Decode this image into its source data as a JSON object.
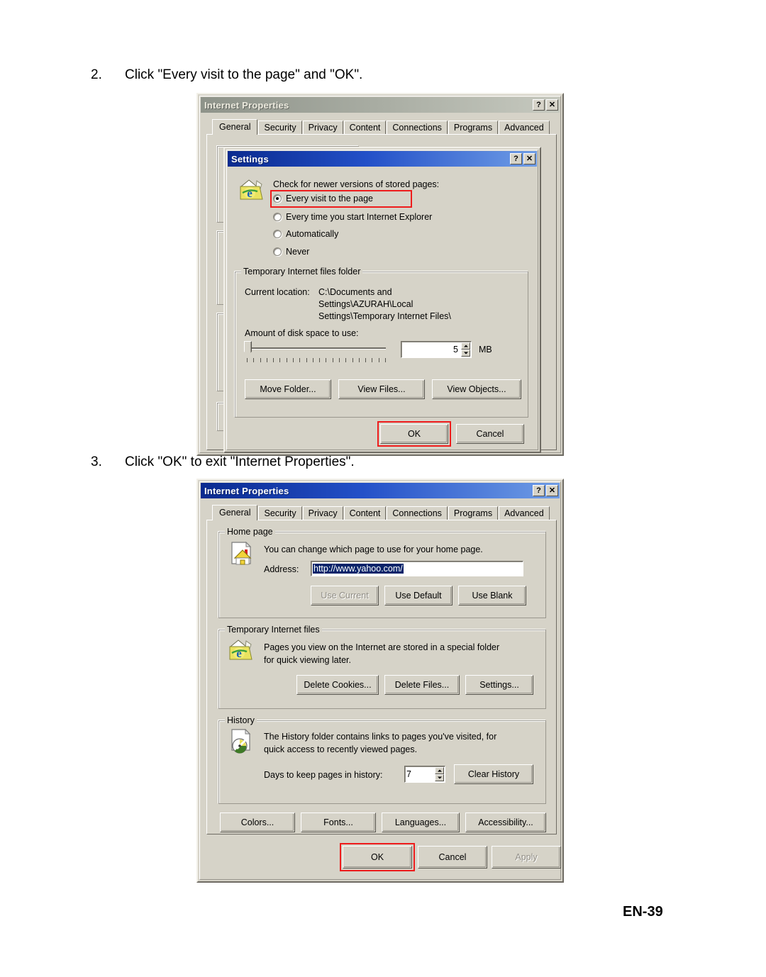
{
  "document": {
    "footer_label": "EN-39"
  },
  "steps": [
    {
      "num": "2.",
      "text": "Click \"Every visit to the page\" and \"OK\"."
    },
    {
      "num": "3.",
      "text": "Click \"OK\" to exit \"Internet Properties\"."
    }
  ],
  "colors": {
    "highlight": "#ee1c1c",
    "dialog_face": "#d6d3c8",
    "active_title": "#0a2a8f",
    "inactive_title": "#8e938a",
    "selection": "#0a246a"
  },
  "dialog_1": {
    "title": "Internet Properties",
    "title_state": "inactive",
    "help_button": "?",
    "close_button": "✕",
    "tabs": [
      {
        "label": "General",
        "selected": true
      },
      {
        "label": "Security",
        "selected": false
      },
      {
        "label": "Privacy",
        "selected": false
      },
      {
        "label": "Content",
        "selected": false
      },
      {
        "label": "Connections",
        "selected": false
      },
      {
        "label": "Programs",
        "selected": false
      },
      {
        "label": "Advanced",
        "selected": false
      }
    ],
    "settings_dialog": {
      "title": "Settings",
      "title_state": "active",
      "help_button": "?",
      "close_button": "✕",
      "check_label": "Check for newer versions of stored pages:",
      "radios": [
        {
          "label": "Every visit to the page",
          "selected": true,
          "highlighted": true
        },
        {
          "label": "Every time you start Internet Explorer",
          "selected": false,
          "highlighted": false
        },
        {
          "label": "Automatically",
          "selected": false,
          "highlighted": false
        },
        {
          "label": "Never",
          "selected": false,
          "highlighted": false
        }
      ],
      "temp_folder_group": {
        "legend": "Temporary Internet files folder",
        "current_location_label": "Current location:",
        "current_location_lines": [
          "C:\\Documents and",
          "Settings\\AZURAH\\Local",
          "Settings\\Temporary Internet Files\\"
        ],
        "disk_space_label": "Amount of disk space to use:",
        "disk_space_value": "5",
        "disk_space_unit": "MB",
        "slider_position_percent": 3,
        "buttons": [
          {
            "label": "Move Folder...",
            "enabled": true
          },
          {
            "label": "View Files...",
            "enabled": true
          },
          {
            "label": "View Objects...",
            "enabled": true
          }
        ]
      },
      "footer_buttons": [
        {
          "label": "OK",
          "enabled": true,
          "highlighted": true
        },
        {
          "label": "Cancel",
          "enabled": true,
          "highlighted": false
        }
      ]
    }
  },
  "dialog_2": {
    "title": "Internet Properties",
    "title_state": "active",
    "help_button": "?",
    "close_button": "✕",
    "tabs": [
      {
        "label": "General",
        "selected": true
      },
      {
        "label": "Security",
        "selected": false
      },
      {
        "label": "Privacy",
        "selected": false
      },
      {
        "label": "Content",
        "selected": false
      },
      {
        "label": "Connections",
        "selected": false
      },
      {
        "label": "Programs",
        "selected": false
      },
      {
        "label": "Advanced",
        "selected": false
      }
    ],
    "home_page_group": {
      "legend": "Home page",
      "description": "You can change which page to use for your home page.",
      "address_label": "Address:",
      "address_value": "http://www.yahoo.com/",
      "address_selected": true,
      "buttons": [
        {
          "label": "Use Current",
          "enabled": false
        },
        {
          "label": "Use Default",
          "enabled": true
        },
        {
          "label": "Use Blank",
          "enabled": true
        }
      ]
    },
    "temp_files_group": {
      "legend": "Temporary Internet files",
      "description_line_1": "Pages you view on the Internet are stored in a special folder",
      "description_line_2": "for quick viewing later.",
      "buttons": [
        {
          "label": "Delete Cookies...",
          "enabled": true
        },
        {
          "label": "Delete Files...",
          "enabled": true
        },
        {
          "label": "Settings...",
          "enabled": true
        }
      ]
    },
    "history_group": {
      "legend": "History",
      "description_line_1": "The History folder contains links to pages you've visited, for",
      "description_line_2": "quick access to recently viewed pages.",
      "days_label": "Days to keep pages in history:",
      "days_value": "7",
      "clear_button": "Clear History"
    },
    "bottom_buttons": [
      {
        "label": "Colors...",
        "enabled": true
      },
      {
        "label": "Fonts...",
        "enabled": true
      },
      {
        "label": "Languages...",
        "enabled": true
      },
      {
        "label": "Accessibility...",
        "enabled": true
      }
    ],
    "footer_buttons": [
      {
        "label": "OK",
        "enabled": true,
        "highlighted": true
      },
      {
        "label": "Cancel",
        "enabled": true,
        "highlighted": false
      },
      {
        "label": "Apply",
        "enabled": false,
        "highlighted": false
      }
    ]
  }
}
